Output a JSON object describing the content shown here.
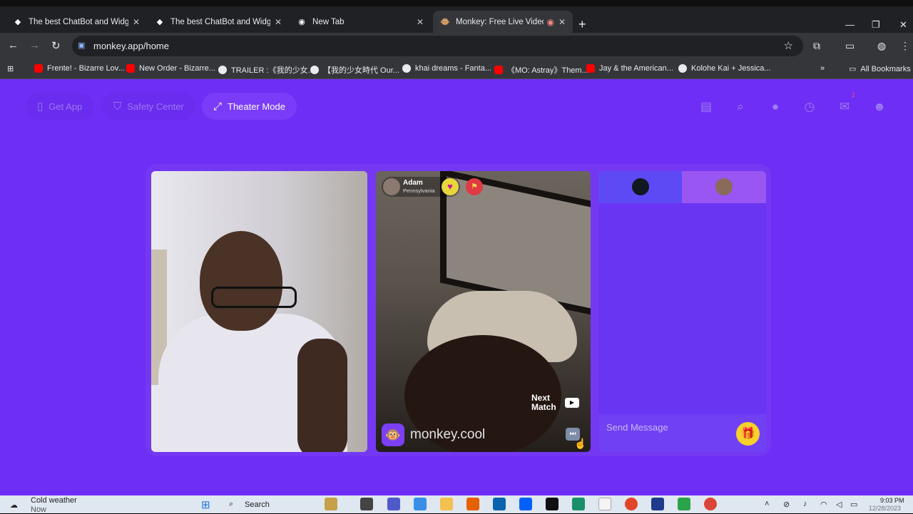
{
  "browser": {
    "tabs": [
      {
        "title": "The best ChatBot and Widgets",
        "active": false
      },
      {
        "title": "The best ChatBot and Widgets",
        "active": false
      },
      {
        "title": "New Tab",
        "active": false
      },
      {
        "title": "Monkey: Free Live Video Ch",
        "active": true
      }
    ],
    "url": "monkey.app/home",
    "bookmarks": [
      "Frente! - Bizarre Lov...",
      "New Order - Bizarre...",
      "TRAILER :《我的少女...",
      "【我的少女時代 Our...",
      "khai dreams - Fanta...",
      "《MO: Astray》Them...",
      "Jay & the American...",
      "Kolohe Kai + Jessica..."
    ],
    "all_bookmarks": "All Bookmarks"
  },
  "header": {
    "get_app": "Get App",
    "safety_center": "Safety Center",
    "theater_mode": "Theater Mode",
    "notification_count": "2"
  },
  "remote": {
    "name": "Adam",
    "location": "Pennsylvania",
    "next_match": "Next Match",
    "watermark": "monkey.cool"
  },
  "chat": {
    "placeholder": "Send Message"
  },
  "taskbar": {
    "weather_title": "Cold weather",
    "weather_sub": "Now",
    "search": "Search",
    "time": "9:03 PM",
    "date": "12/28/2023"
  },
  "colors": {
    "page_bg": "#6f2ef5",
    "accent": "#7a3cf8",
    "gift": "#f7d02a"
  }
}
